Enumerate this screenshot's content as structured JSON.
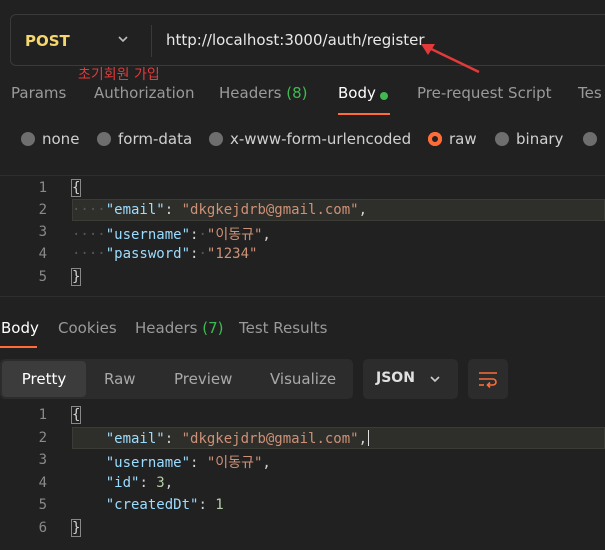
{
  "request": {
    "method": "POST",
    "url": "http://localhost:3000/auth/register",
    "annotation": "초기회원 가입"
  },
  "request_tabs": [
    {
      "label": "Params"
    },
    {
      "label": "Authorization"
    },
    {
      "label": "Headers",
      "count": "(8)"
    },
    {
      "label": "Body"
    },
    {
      "label": "Pre-request Script"
    },
    {
      "label": "Tes"
    }
  ],
  "body_types": [
    "none",
    "form-data",
    "x-www-form-urlencoded",
    "raw",
    "binary"
  ],
  "request_body": {
    "line_numbers": [
      "1",
      "2",
      "3",
      "4",
      "5"
    ],
    "open": "{",
    "close": "}",
    "email_key": "\"email\"",
    "email_val": "\"dkgkejdrb@gmail.com\"",
    "username_key": "\"username\"",
    "username_val": "\"이동규\"",
    "password_key": "\"password\"",
    "password_val": "\"1234\""
  },
  "response_tabs": [
    {
      "label": "Body"
    },
    {
      "label": "Cookies"
    },
    {
      "label": "Headers",
      "count": "(7)"
    },
    {
      "label": "Test Results"
    }
  ],
  "view_modes": [
    "Pretty",
    "Raw",
    "Preview",
    "Visualize"
  ],
  "format": "JSON",
  "response_body": {
    "line_numbers": [
      "1",
      "2",
      "3",
      "4",
      "5",
      "6"
    ],
    "open": "{",
    "close": "}",
    "email_key": "\"email\"",
    "email_val": "\"dkgkejdrb@gmail.com\"",
    "username_key": "\"username\"",
    "username_val": "\"이동규\"",
    "id_key": "\"id\"",
    "id_val": "3",
    "created_key": "\"createdDt\"",
    "created_val": "1"
  },
  "colors": {
    "accent": "#ff6c37",
    "method": "#f5d76e",
    "count_green": "#3fb950",
    "annotation_red": "#e23a3a"
  }
}
